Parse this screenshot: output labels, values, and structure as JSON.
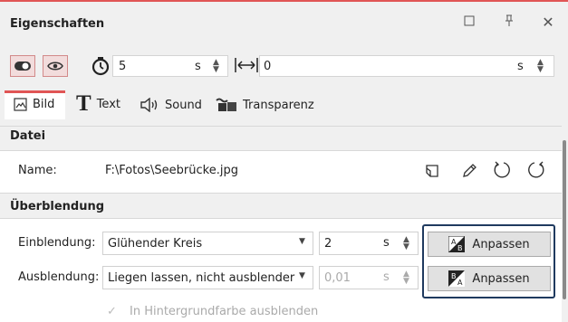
{
  "titlebar": {
    "title": "Eigenschaften",
    "restore": "☐",
    "pin": "⊥",
    "close": "✕"
  },
  "toolbar": {
    "duration_value": "5",
    "duration_unit": "s",
    "offset_value": "0",
    "offset_unit": "s"
  },
  "tabs": [
    {
      "label": "Bild",
      "selected": true
    },
    {
      "label": "Text",
      "selected": false
    },
    {
      "label": "Sound",
      "selected": false
    },
    {
      "label": "Transparenz",
      "selected": false
    }
  ],
  "datei": {
    "heading": "Datei",
    "name_label": "Name:",
    "name_value": "F:\\Fotos\\Seebrücke.jpg"
  },
  "ueberblendung": {
    "heading": "Überblendung",
    "ein_label": "Einblendung:",
    "ein_value": "Glühender Kreis",
    "ein_duration": "2",
    "ein_unit": "s",
    "aus_label": "Ausblendung:",
    "aus_value": "Liegen lassen, nicht ausblender",
    "aus_duration": "0,01",
    "aus_unit": "s",
    "anpassen1": "Anpassen",
    "anpassen2": "Anpassen",
    "checkbox_label": "In Hintergrundfarbe ausblenden",
    "checkbox_checked": true,
    "checkbox_enabled": false
  },
  "colors": {
    "accent": "#e05555",
    "focus_border": "#1f3a5f"
  }
}
